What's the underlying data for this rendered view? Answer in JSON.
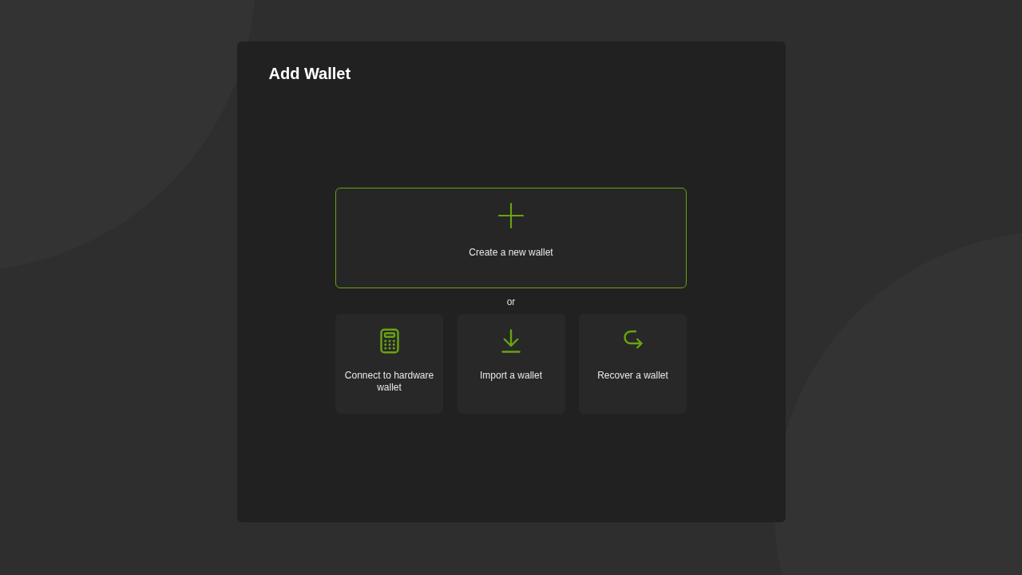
{
  "dialog": {
    "title": "Add Wallet"
  },
  "primary_option": {
    "label": "Create a new wallet"
  },
  "separator": "or",
  "options": [
    {
      "kind": "hardware",
      "label": "Connect to hardware wallet"
    },
    {
      "kind": "import",
      "label": "Import a wallet"
    },
    {
      "kind": "recover",
      "label": "Recover a wallet"
    }
  ]
}
